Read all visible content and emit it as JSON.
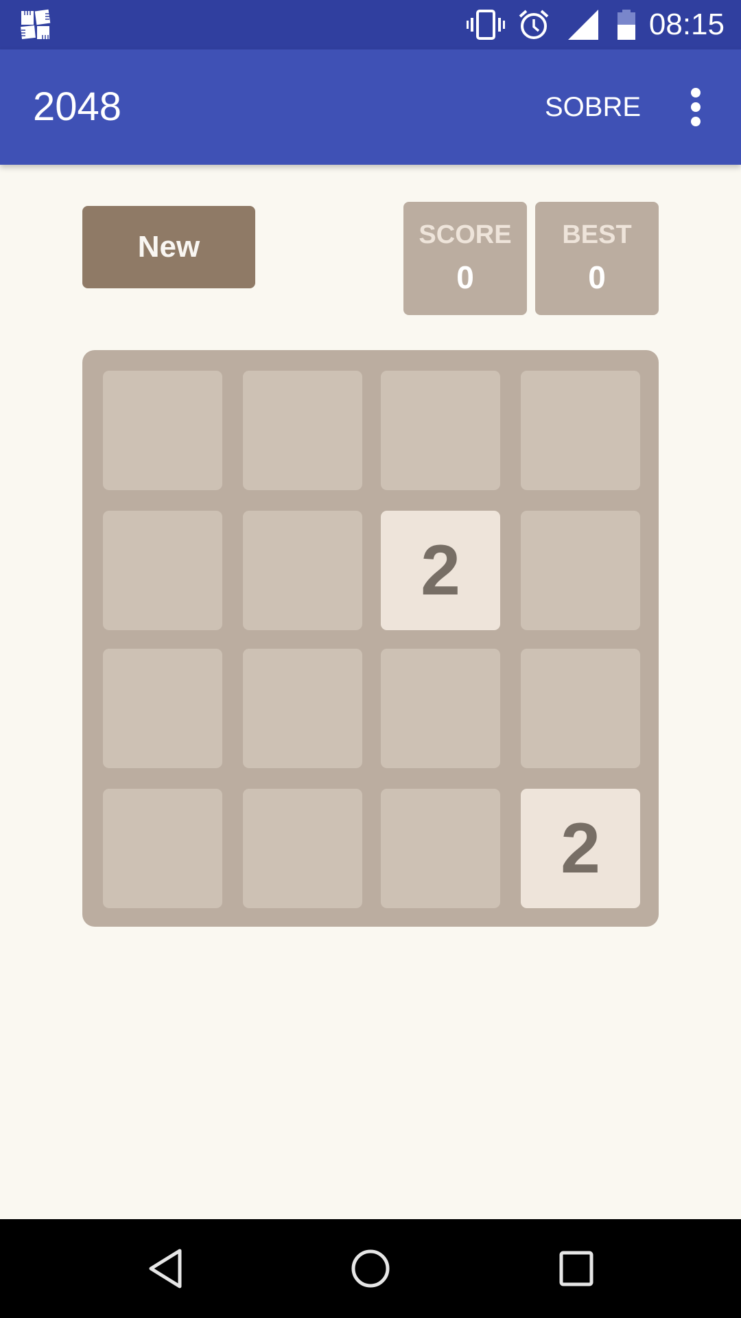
{
  "status_bar": {
    "time": "08:15",
    "icons": [
      "app-notification-icon",
      "vibrate-icon",
      "alarm-icon",
      "signal-icon",
      "battery-icon"
    ]
  },
  "app_bar": {
    "title": "2048",
    "action_label": "SOBRE",
    "overflow_icon": "more-vert-icon"
  },
  "controls": {
    "new_label": "New",
    "score_label": "SCORE",
    "score_value": "0",
    "best_label": "BEST",
    "best_value": "0"
  },
  "board": {
    "size": 4,
    "tiles": [
      [
        0,
        0,
        0,
        0
      ],
      [
        0,
        0,
        2,
        0
      ],
      [
        0,
        0,
        0,
        0
      ],
      [
        0,
        0,
        0,
        2
      ]
    ]
  },
  "colors": {
    "status_bar": "#303f9f",
    "app_bar": "#3f51b5",
    "background": "#faf8f1",
    "board": "#bbada0",
    "empty_cell": "#cdc1b4",
    "tile_2": "#eee4da",
    "tile_text": "#776e65",
    "new_button": "#8f7a66"
  },
  "nav_bar": {
    "icons": [
      "back-icon",
      "home-icon",
      "recents-icon"
    ]
  }
}
